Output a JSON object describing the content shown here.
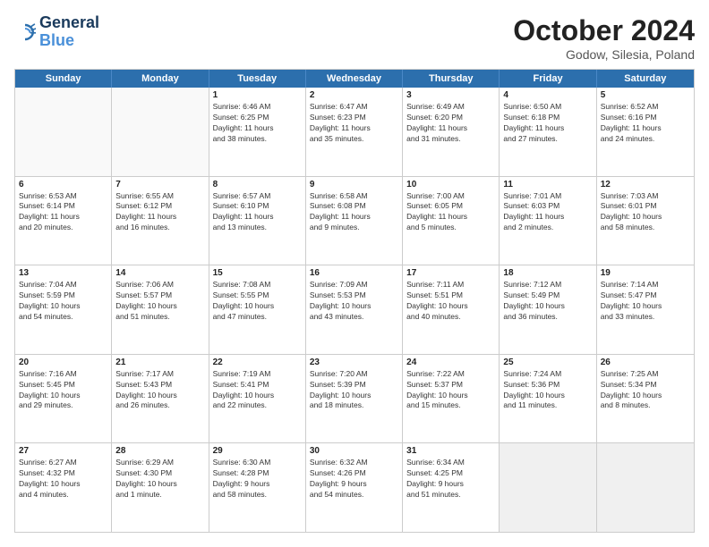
{
  "logo": {
    "line1": "General",
    "line2": "Blue"
  },
  "title": "October 2024",
  "location": "Godow, Silesia, Poland",
  "headers": [
    "Sunday",
    "Monday",
    "Tuesday",
    "Wednesday",
    "Thursday",
    "Friday",
    "Saturday"
  ],
  "rows": [
    [
      {
        "day": "",
        "lines": [],
        "empty": true
      },
      {
        "day": "",
        "lines": [],
        "empty": true
      },
      {
        "day": "1",
        "lines": [
          "Sunrise: 6:46 AM",
          "Sunset: 6:25 PM",
          "Daylight: 11 hours",
          "and 38 minutes."
        ]
      },
      {
        "day": "2",
        "lines": [
          "Sunrise: 6:47 AM",
          "Sunset: 6:23 PM",
          "Daylight: 11 hours",
          "and 35 minutes."
        ]
      },
      {
        "day": "3",
        "lines": [
          "Sunrise: 6:49 AM",
          "Sunset: 6:20 PM",
          "Daylight: 11 hours",
          "and 31 minutes."
        ]
      },
      {
        "day": "4",
        "lines": [
          "Sunrise: 6:50 AM",
          "Sunset: 6:18 PM",
          "Daylight: 11 hours",
          "and 27 minutes."
        ]
      },
      {
        "day": "5",
        "lines": [
          "Sunrise: 6:52 AM",
          "Sunset: 6:16 PM",
          "Daylight: 11 hours",
          "and 24 minutes."
        ]
      }
    ],
    [
      {
        "day": "6",
        "lines": [
          "Sunrise: 6:53 AM",
          "Sunset: 6:14 PM",
          "Daylight: 11 hours",
          "and 20 minutes."
        ]
      },
      {
        "day": "7",
        "lines": [
          "Sunrise: 6:55 AM",
          "Sunset: 6:12 PM",
          "Daylight: 11 hours",
          "and 16 minutes."
        ]
      },
      {
        "day": "8",
        "lines": [
          "Sunrise: 6:57 AM",
          "Sunset: 6:10 PM",
          "Daylight: 11 hours",
          "and 13 minutes."
        ]
      },
      {
        "day": "9",
        "lines": [
          "Sunrise: 6:58 AM",
          "Sunset: 6:08 PM",
          "Daylight: 11 hours",
          "and 9 minutes."
        ]
      },
      {
        "day": "10",
        "lines": [
          "Sunrise: 7:00 AM",
          "Sunset: 6:05 PM",
          "Daylight: 11 hours",
          "and 5 minutes."
        ]
      },
      {
        "day": "11",
        "lines": [
          "Sunrise: 7:01 AM",
          "Sunset: 6:03 PM",
          "Daylight: 11 hours",
          "and 2 minutes."
        ]
      },
      {
        "day": "12",
        "lines": [
          "Sunrise: 7:03 AM",
          "Sunset: 6:01 PM",
          "Daylight: 10 hours",
          "and 58 minutes."
        ]
      }
    ],
    [
      {
        "day": "13",
        "lines": [
          "Sunrise: 7:04 AM",
          "Sunset: 5:59 PM",
          "Daylight: 10 hours",
          "and 54 minutes."
        ]
      },
      {
        "day": "14",
        "lines": [
          "Sunrise: 7:06 AM",
          "Sunset: 5:57 PM",
          "Daylight: 10 hours",
          "and 51 minutes."
        ]
      },
      {
        "day": "15",
        "lines": [
          "Sunrise: 7:08 AM",
          "Sunset: 5:55 PM",
          "Daylight: 10 hours",
          "and 47 minutes."
        ]
      },
      {
        "day": "16",
        "lines": [
          "Sunrise: 7:09 AM",
          "Sunset: 5:53 PM",
          "Daylight: 10 hours",
          "and 43 minutes."
        ]
      },
      {
        "day": "17",
        "lines": [
          "Sunrise: 7:11 AM",
          "Sunset: 5:51 PM",
          "Daylight: 10 hours",
          "and 40 minutes."
        ]
      },
      {
        "day": "18",
        "lines": [
          "Sunrise: 7:12 AM",
          "Sunset: 5:49 PM",
          "Daylight: 10 hours",
          "and 36 minutes."
        ]
      },
      {
        "day": "19",
        "lines": [
          "Sunrise: 7:14 AM",
          "Sunset: 5:47 PM",
          "Daylight: 10 hours",
          "and 33 minutes."
        ]
      }
    ],
    [
      {
        "day": "20",
        "lines": [
          "Sunrise: 7:16 AM",
          "Sunset: 5:45 PM",
          "Daylight: 10 hours",
          "and 29 minutes."
        ]
      },
      {
        "day": "21",
        "lines": [
          "Sunrise: 7:17 AM",
          "Sunset: 5:43 PM",
          "Daylight: 10 hours",
          "and 26 minutes."
        ]
      },
      {
        "day": "22",
        "lines": [
          "Sunrise: 7:19 AM",
          "Sunset: 5:41 PM",
          "Daylight: 10 hours",
          "and 22 minutes."
        ]
      },
      {
        "day": "23",
        "lines": [
          "Sunrise: 7:20 AM",
          "Sunset: 5:39 PM",
          "Daylight: 10 hours",
          "and 18 minutes."
        ]
      },
      {
        "day": "24",
        "lines": [
          "Sunrise: 7:22 AM",
          "Sunset: 5:37 PM",
          "Daylight: 10 hours",
          "and 15 minutes."
        ]
      },
      {
        "day": "25",
        "lines": [
          "Sunrise: 7:24 AM",
          "Sunset: 5:36 PM",
          "Daylight: 10 hours",
          "and 11 minutes."
        ]
      },
      {
        "day": "26",
        "lines": [
          "Sunrise: 7:25 AM",
          "Sunset: 5:34 PM",
          "Daylight: 10 hours",
          "and 8 minutes."
        ]
      }
    ],
    [
      {
        "day": "27",
        "lines": [
          "Sunrise: 6:27 AM",
          "Sunset: 4:32 PM",
          "Daylight: 10 hours",
          "and 4 minutes."
        ]
      },
      {
        "day": "28",
        "lines": [
          "Sunrise: 6:29 AM",
          "Sunset: 4:30 PM",
          "Daylight: 10 hours",
          "and 1 minute."
        ]
      },
      {
        "day": "29",
        "lines": [
          "Sunrise: 6:30 AM",
          "Sunset: 4:28 PM",
          "Daylight: 9 hours",
          "and 58 minutes."
        ]
      },
      {
        "day": "30",
        "lines": [
          "Sunrise: 6:32 AM",
          "Sunset: 4:26 PM",
          "Daylight: 9 hours",
          "and 54 minutes."
        ]
      },
      {
        "day": "31",
        "lines": [
          "Sunrise: 6:34 AM",
          "Sunset: 4:25 PM",
          "Daylight: 9 hours",
          "and 51 minutes."
        ]
      },
      {
        "day": "",
        "lines": [],
        "empty": true,
        "shaded": true
      },
      {
        "day": "",
        "lines": [],
        "empty": true,
        "shaded": true
      }
    ]
  ]
}
